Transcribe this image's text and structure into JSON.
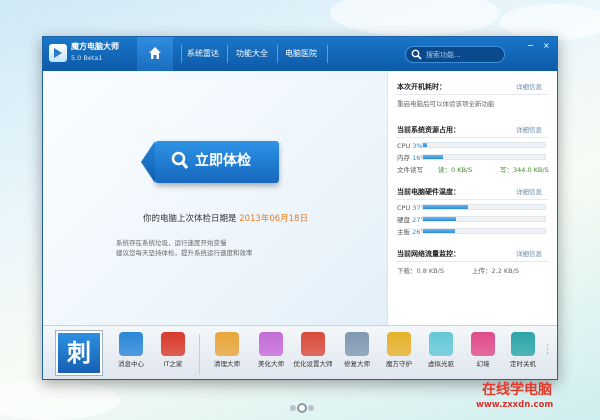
{
  "app": {
    "name": "魔方电脑大师",
    "version": "5.0  Beta1"
  },
  "nav": {
    "tabs": [
      "系统雷达",
      "功能大全",
      "电脑医院"
    ],
    "search_placeholder": "搜索功能...",
    "window_controls": [
      "−",
      "×"
    ]
  },
  "main": {
    "check_button": "立即体检",
    "last_check_prefix": "你的电脑上次体检日期是 ",
    "last_check_date": "2013年06月18日",
    "tips": [
      "系统存在系统垃圾，运行速度开始变慢",
      "建议您每天坚持体检，提升系统运行速度和效率"
    ]
  },
  "sidebar": {
    "more": "详细信息",
    "boot": {
      "title": "本次开机耗时：",
      "text": "重启电脑后可以体验该项全新功能"
    },
    "resources": {
      "title": "当前系统资源占用：",
      "cpu_label": "CPU",
      "cpu_value": "3%",
      "cpu_percent": 3,
      "mem_label": "内存",
      "mem_value": "16%",
      "mem_percent": 16,
      "io_label": "文件读写",
      "io_read": "读：0 KB/S",
      "io_write": "写：344.0 KB/S"
    },
    "temps": {
      "title": "当前电脑硬件温度：",
      "items": [
        {
          "label": "CPU",
          "value": "37℃",
          "percent": 37
        },
        {
          "label": "硬盘",
          "value": "27℃",
          "percent": 27
        },
        {
          "label": "主板",
          "value": "26℃",
          "percent": 26
        }
      ]
    },
    "network": {
      "title": "当前网络流量监控：",
      "download": "下载：0.8 KB/S",
      "upload": "上传：2.2 KB/S"
    }
  },
  "toolbar": {
    "cinema_char": "刺",
    "items": [
      {
        "label": "消息中心",
        "icon": "message-center-icon",
        "color": "#2a86d8"
      },
      {
        "label": "IT之家",
        "icon": "it-home-icon",
        "color": "#d93a2a"
      },
      {
        "label": "清理大师",
        "icon": "broom-icon",
        "color": "#e9a53a"
      },
      {
        "label": "美化大师",
        "icon": "brush-icon",
        "color": "#c46ad8"
      },
      {
        "label": "优化设置大师",
        "icon": "rocket-icon",
        "color": "#d94a3a"
      },
      {
        "label": "修复大师",
        "icon": "wrench-icon",
        "color": "#7f98b0"
      },
      {
        "label": "魔方守护",
        "icon": "shield-icon",
        "color": "#e6b12a"
      },
      {
        "label": "虚拟光驱",
        "icon": "disc-icon",
        "color": "#64c8d8"
      },
      {
        "label": "幻境",
        "icon": "balloon-icon",
        "color": "#e04a8a"
      },
      {
        "label": "定时关机",
        "icon": "power-icon",
        "color": "#2aa5a8"
      }
    ]
  },
  "watermark": {
    "text": "在线学电脑",
    "url": "www.zxxdn.com"
  }
}
